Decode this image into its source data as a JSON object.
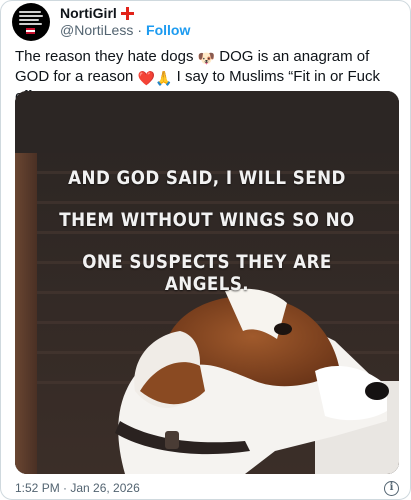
{
  "author": {
    "display_name": "NortiGirl",
    "flag_icon": "england-flag-icon",
    "handle": "@NortiLess",
    "separator": "·",
    "follow_label": "Follow"
  },
  "tweet": {
    "text_1": "The reason they hate dogs ",
    "emoji_dog": "🐶",
    "text_2": " DOG is an anagram of GOD for a reason ",
    "emoji_heart": "❤️",
    "emoji_pray": "🙏",
    "text_3": " I say to Muslims “Fit in or Fuck off” ",
    "emoji_fist": "👊"
  },
  "media": {
    "caption_line_1": "AND GOD SAID, I WILL SEND",
    "caption_line_2": "THEM WITHOUT WINGS SO NO",
    "caption_line_3": "ONE SUSPECTS THEY ARE ANGELS."
  },
  "footer": {
    "timestamp": "1:52 PM · Jan 26, 2026",
    "info_icon": "info-icon",
    "info_glyph": "i"
  },
  "colors": {
    "link_blue": "#1d9bf0",
    "text_primary": "#0f1419",
    "text_secondary": "#536471",
    "border": "#cfd9de"
  }
}
